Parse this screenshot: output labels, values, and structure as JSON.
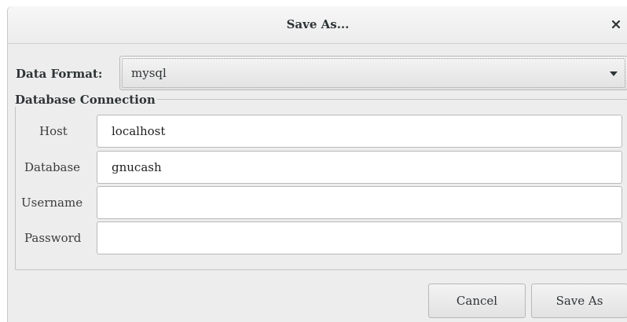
{
  "dialog": {
    "title": "Save As...",
    "close_icon": "close-icon"
  },
  "format": {
    "label": "Data Format:",
    "selected": "mysql",
    "arrow_icon": "chevron-down-icon"
  },
  "connection": {
    "frame_label": "Database Connection",
    "fields": [
      {
        "label": "Host",
        "value": "localhost"
      },
      {
        "label": "Database",
        "value": "gnucash"
      },
      {
        "label": "Username",
        "value": ""
      },
      {
        "label": "Password",
        "value": ""
      }
    ]
  },
  "buttons": {
    "cancel": "Cancel",
    "save": "Save As"
  }
}
